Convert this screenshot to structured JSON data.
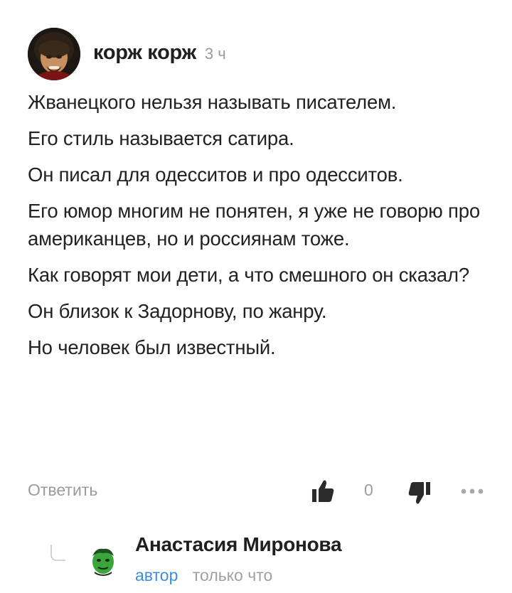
{
  "comment": {
    "author": "корж корж",
    "time": "3 ч",
    "paragraphs": [
      "Жванецкого нельзя называть писателем.",
      "Его стиль называется сатира.",
      "Он писал для одесситов и про одесситов.",
      "Его юмор многим не понятен, я уже не говорю про американцев, но и россиянам тоже.",
      "Как говорят мои дети, а что смешного он сказал?",
      "Он близок к Задорнову, по жанру.",
      "Но человек был известный."
    ],
    "actions": {
      "reply_label": "Ответить",
      "vote_count": "0",
      "like_icon": "thumbs-up-icon",
      "dislike_icon": "thumbs-down-icon",
      "more_icon": "more-dots-icon"
    }
  },
  "reply": {
    "author": "Анастасия Миронова",
    "author_tag": "автор",
    "time": "только что"
  },
  "colors": {
    "text": "#222222",
    "muted": "#9c9c9c",
    "accent": "#3c8ee0",
    "icon": "#2a2a2a"
  }
}
